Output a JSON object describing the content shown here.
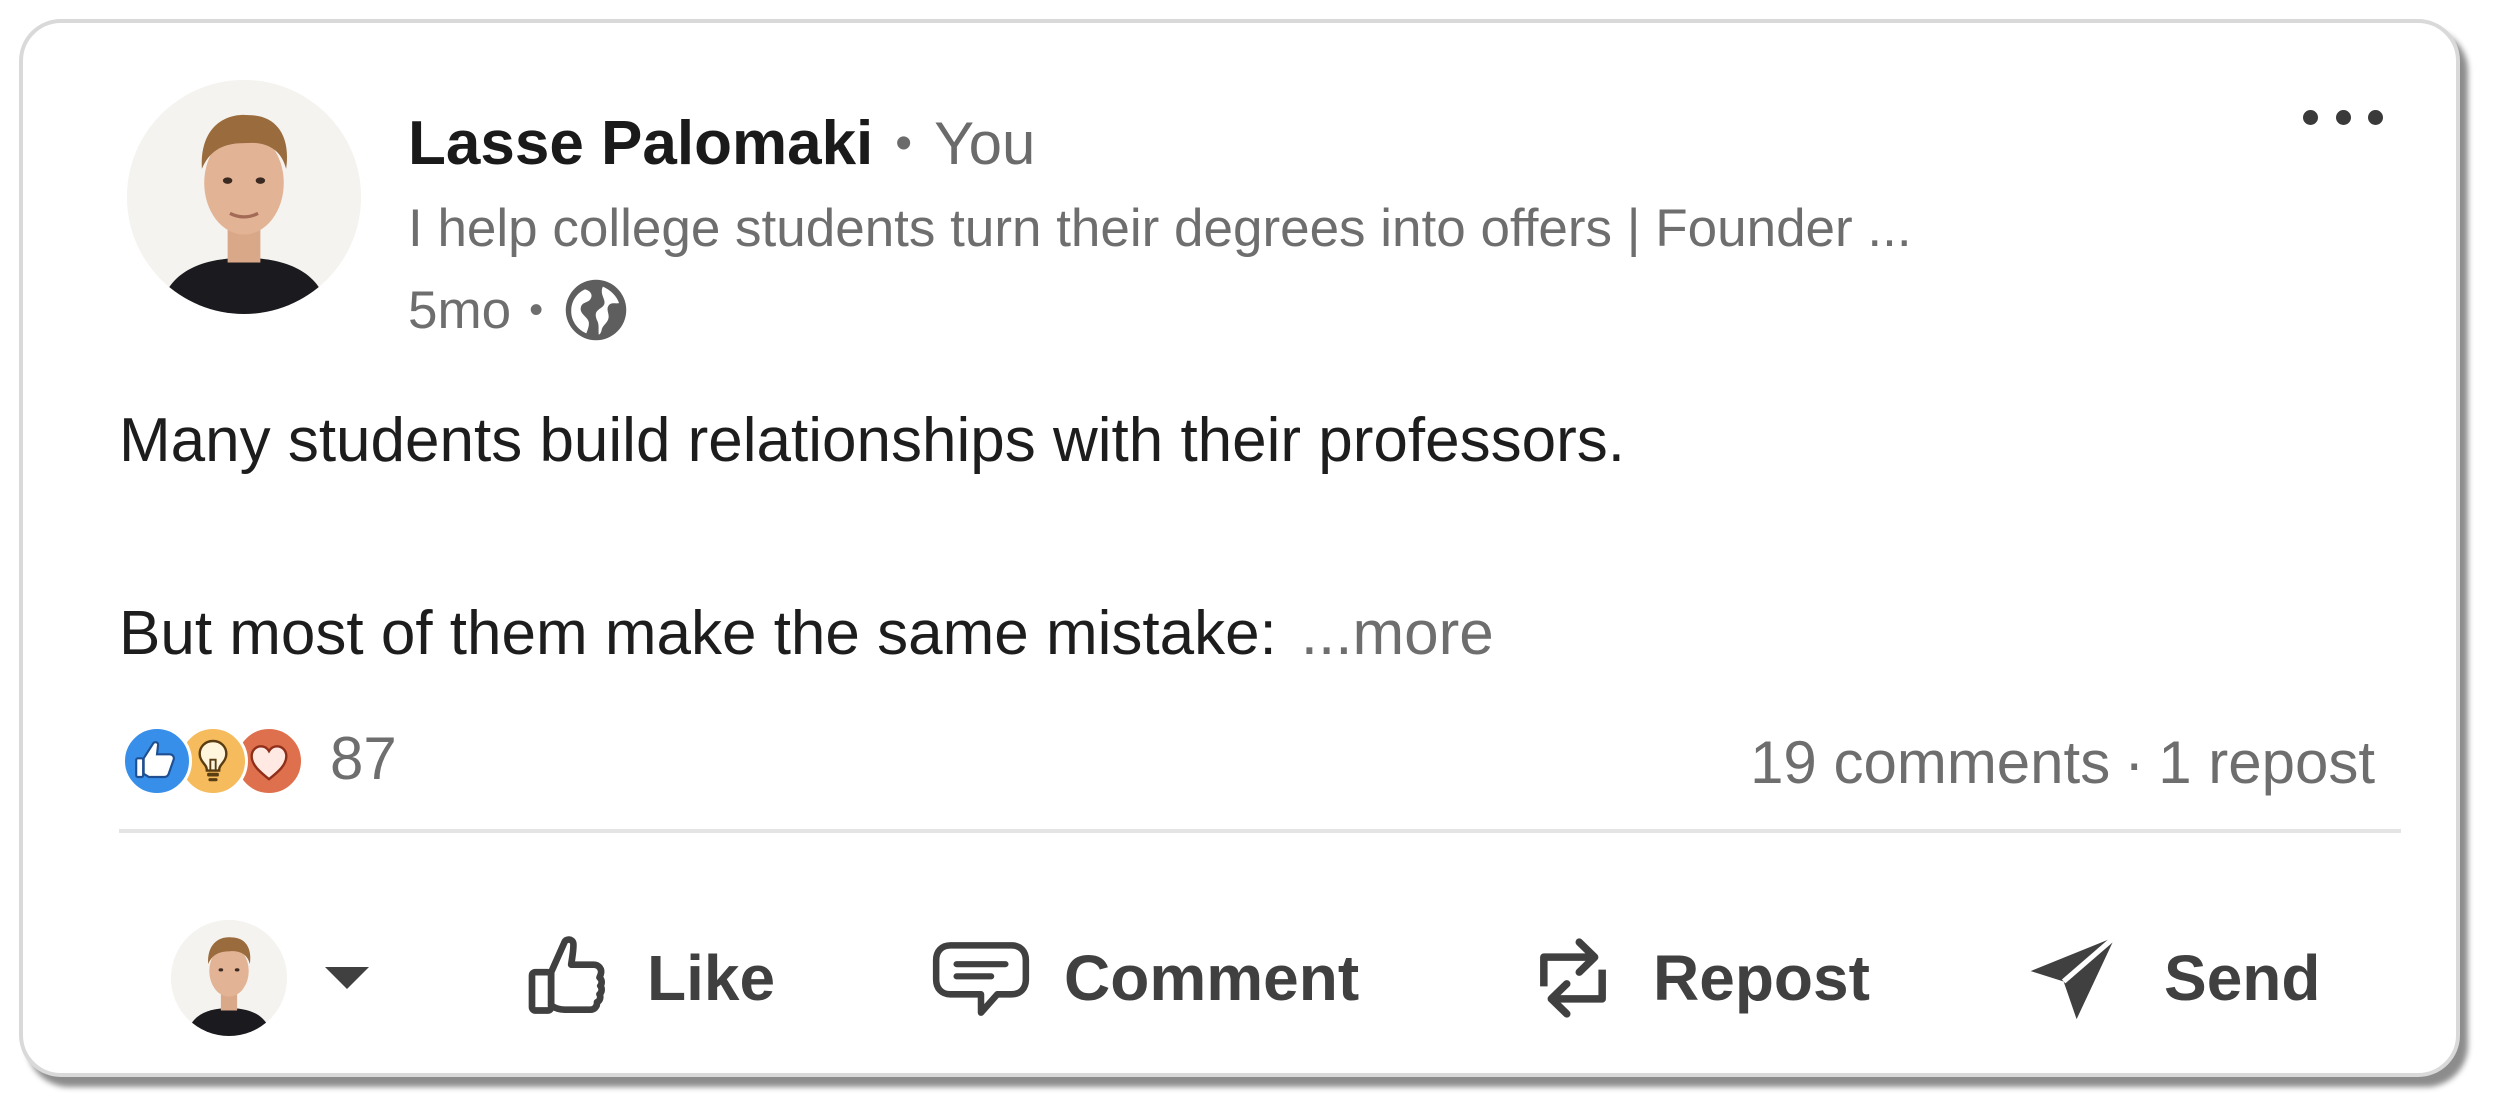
{
  "post": {
    "author": {
      "name": "Lasse Palomaki",
      "separator": "•",
      "relation": "You",
      "headline": "I help college students turn their degrees into offers | Founder ...",
      "age": "5mo",
      "meta_separator": "•",
      "visibility_icon": "globe-icon",
      "avatar_icon": "profile-photo"
    },
    "menu_icon": "more-options-icon",
    "content": {
      "line1": "Many students build relationships with their professors.",
      "line2": "But most of them make the same mistake:",
      "see_more": "...more"
    },
    "social": {
      "reactions": [
        "like",
        "insightful",
        "love"
      ],
      "reaction_count": "87",
      "comments": "19 comments",
      "separator": "·",
      "reposts": "1 repost"
    },
    "actions": {
      "like": "Like",
      "comment": "Comment",
      "repost": "Repost",
      "send": "Send"
    },
    "colors": {
      "like_reaction": "#378fe9",
      "insightful_reaction": "#f5bb5c",
      "love_reaction": "#df704d",
      "action_text": "#404040",
      "secondary_text": "#6e6e6e"
    }
  }
}
